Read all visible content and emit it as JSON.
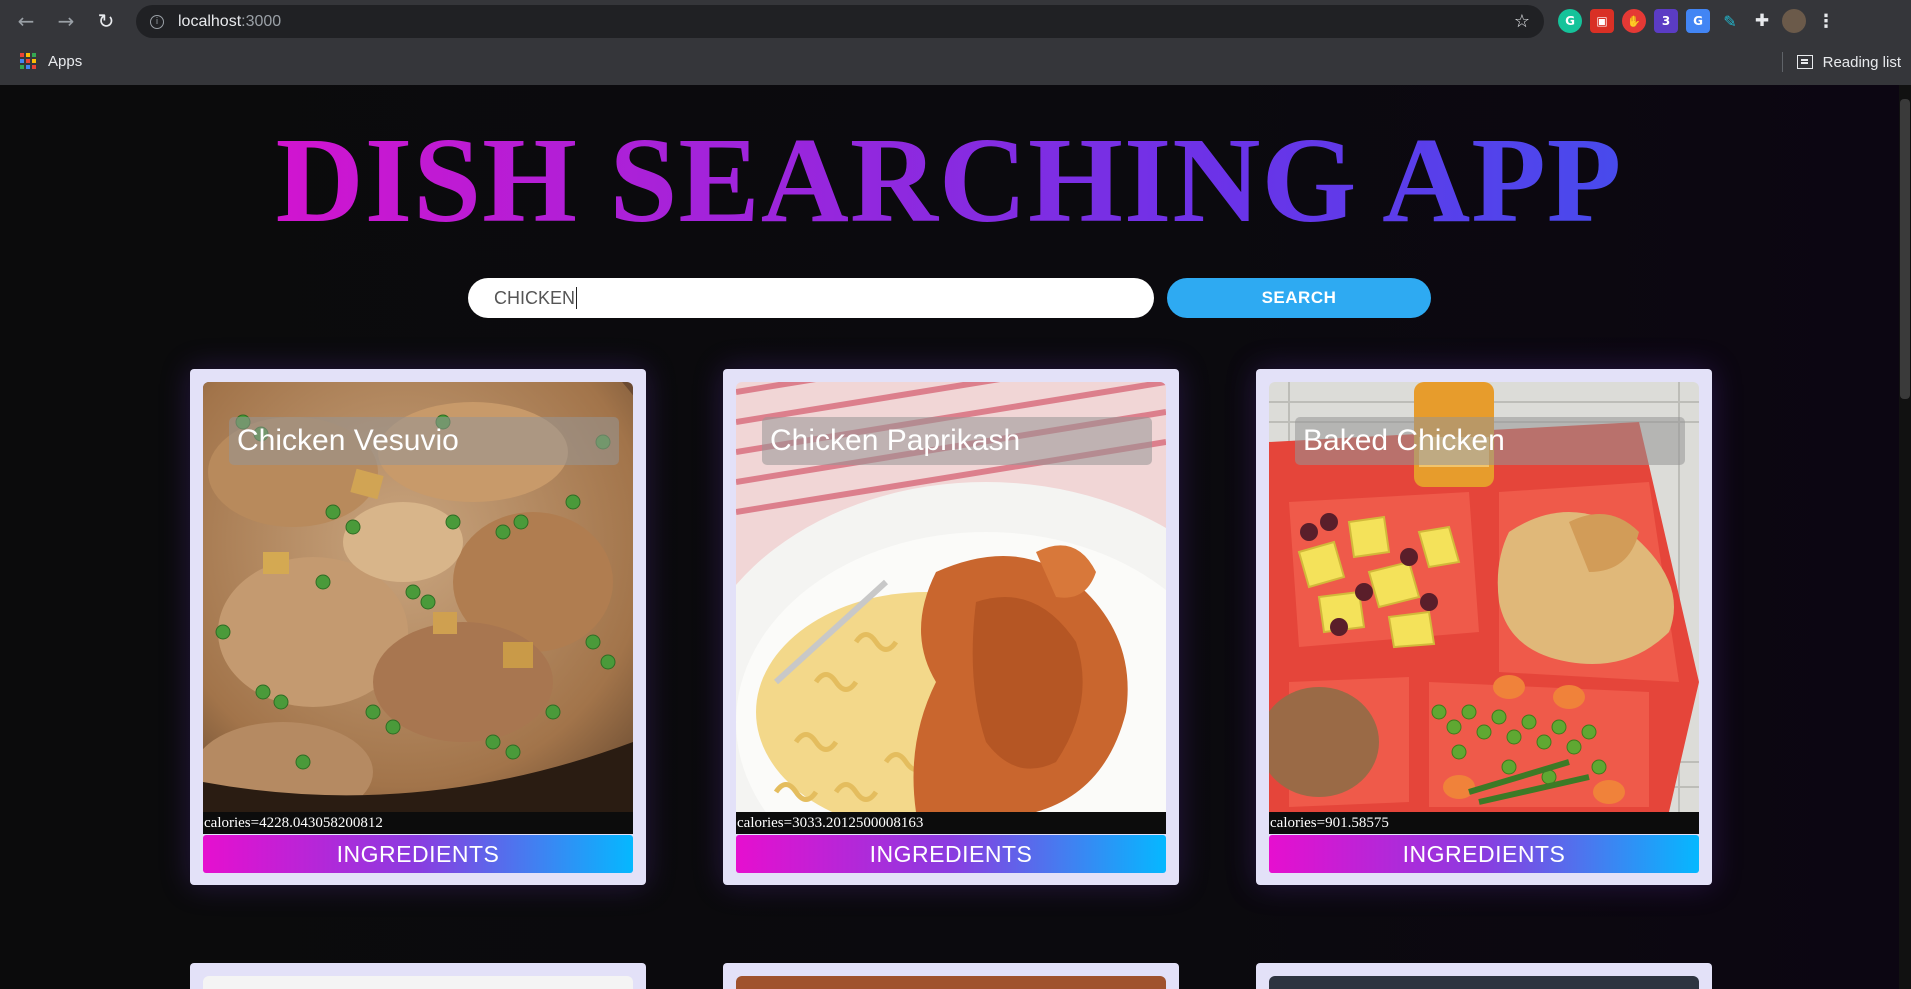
{
  "browser": {
    "url_host": "localhost",
    "url_port": ":3000",
    "bookmarks_apps_label": "Apps",
    "reading_list_label": "Reading list",
    "extensions": [
      {
        "icon": "grammarly-icon",
        "glyph": "G",
        "color": "#15c39a"
      },
      {
        "icon": "extension-red-icon",
        "glyph": "▣",
        "color": "#d93025"
      },
      {
        "icon": "adblock-icon",
        "glyph": "✋",
        "color": "#e53935"
      },
      {
        "icon": "extension-badge-icon",
        "glyph": "3",
        "color": "#5b3cc4"
      },
      {
        "icon": "google-translate-icon",
        "glyph": "G",
        "color": "#4285f4"
      },
      {
        "icon": "pen-tool-icon",
        "glyph": "✎",
        "color": "#22b8cf"
      },
      {
        "icon": "puzzle-icon",
        "glyph": "✚",
        "color": "#35363a"
      },
      {
        "icon": "profile-avatar-icon",
        "glyph": "●",
        "color": "#6b5a4a"
      },
      {
        "icon": "menu-dots-icon",
        "glyph": "⋮",
        "color": "#35363a"
      }
    ]
  },
  "app": {
    "title": "DISH SEARCHING APP",
    "search": {
      "value": "CHICKEN",
      "button_label": "SEARCH"
    },
    "recipes": [
      {
        "title": "Chicken Vesuvio",
        "calories": "calories=4228.043058200812",
        "button_label": "INGREDIENTS"
      },
      {
        "title": "Chicken Paprikash",
        "calories": "calories=3033.2012500008163",
        "button_label": "INGREDIENTS"
      },
      {
        "title": "Baked Chicken",
        "calories": "calories=901.58575",
        "button_label": "INGREDIENTS"
      }
    ]
  }
}
